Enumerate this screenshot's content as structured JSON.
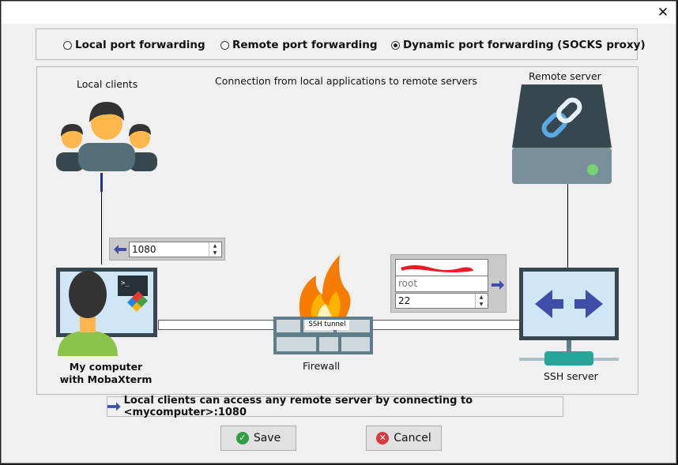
{
  "window": {
    "close_label": "✕"
  },
  "modes": [
    {
      "label": "Local port forwarding",
      "selected": false
    },
    {
      "label": "Remote port forwarding",
      "selected": false
    },
    {
      "label": "Dynamic port forwarding (SOCKS proxy)",
      "selected": true
    }
  ],
  "diagram": {
    "heading": "Connection from local applications to remote servers",
    "local_clients_label": "Local clients",
    "remote_server_label": "Remote server",
    "my_computer_label": "My computer",
    "my_computer_sub": "with MobaXterm",
    "firewall_label": "Firewall",
    "ssh_server_label": "SSH server",
    "tunnel_label": "SSH tunnel",
    "forward_port": "1080",
    "ssh_user": "root",
    "ssh_port": "22"
  },
  "info": {
    "text": "Local clients can access any remote server by connecting to <mycomputer>:1080"
  },
  "buttons": {
    "save": "Save",
    "cancel": "Cancel"
  },
  "colors": {
    "accent_blue": "#3f4fa8",
    "save_green": "#2ea043",
    "cancel_red": "#d9393b",
    "monitor_blue": "#cfe6f7",
    "fire_orange": "#f57c00"
  }
}
